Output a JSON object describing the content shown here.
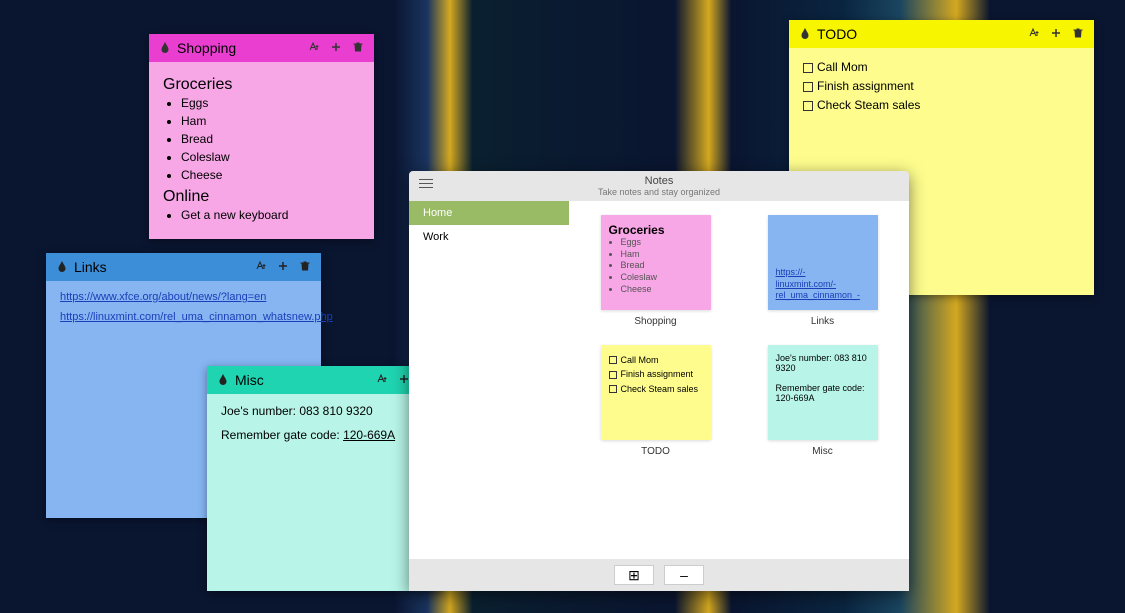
{
  "sticky": {
    "shopping": {
      "title": "Shopping",
      "heading1": "Groceries",
      "items1": [
        "Eggs",
        "Ham",
        "Bread",
        "Coleslaw",
        "Cheese"
      ],
      "heading2": "Online",
      "items2": [
        "Get a new keyboard"
      ]
    },
    "links": {
      "title": "Links",
      "urls": [
        "https://www.xfce.org/about/news/?lang=en",
        "https://linuxmint.com/rel_uma_cinnamon_whatsnew.php"
      ]
    },
    "misc": {
      "title": "Misc",
      "line1": "Joe's number: 083 810 9320",
      "line2_pre": "Remember gate code: ",
      "line2_code": "120-669A"
    },
    "todo": {
      "title": "TODO",
      "items": [
        "Call Mom",
        "Finish assignment",
        "Check Steam sales"
      ]
    }
  },
  "app": {
    "title": "Notes",
    "subtitle": "Take notes and stay organized",
    "sidebar": {
      "home": "Home",
      "work": "Work"
    },
    "cards": {
      "shopping": {
        "label": "Shopping",
        "heading": "Groceries",
        "items": [
          "Eggs",
          "Ham",
          "Bread",
          "Coleslaw",
          "Cheese"
        ]
      },
      "links": {
        "label": "Links",
        "url1_a": "https://-",
        "url1_b": "linuxmint.com/-",
        "url1_c": "rel_uma_cinnamon_-"
      },
      "todo": {
        "label": "TODO",
        "items": [
          "Call Mom",
          "Finish assignment",
          "Check Steam sales"
        ]
      },
      "misc": {
        "label": "Misc",
        "line1": "Joe's number: 083 810 9320",
        "line2": "Remember gate code: 120-669A"
      }
    },
    "footer": {
      "add": "⊞",
      "remove": "–"
    }
  }
}
